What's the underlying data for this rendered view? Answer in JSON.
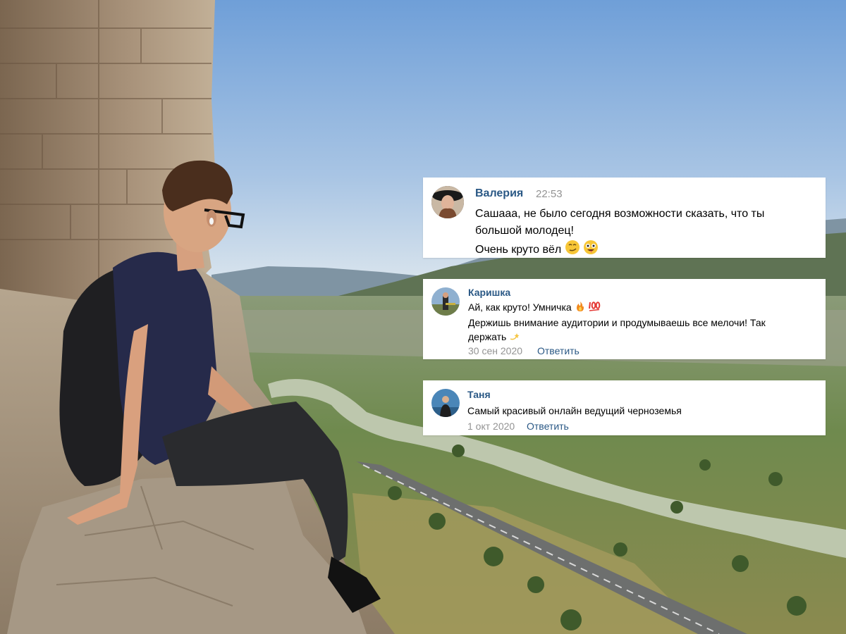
{
  "photo": {
    "description_icon": "landscape-photo",
    "colors": {
      "sky_top": "#6e9fd7",
      "sky_bottom": "#d7e4ef",
      "stone": "#a89277",
      "river": "#b9c6a9",
      "greenery": "#5d7a3f"
    }
  },
  "comments": [
    {
      "author": "Валерия",
      "time": "22:53",
      "lines": [
        "Сашааа, не было сегодня возможности сказать, что ты",
        "большой молодец!",
        "Очень круто вёл"
      ],
      "emoji_icons": [
        "smirk-face-icon",
        "zany-face-icon"
      ]
    },
    {
      "author": "Каришка",
      "lines": [
        "Ай, как круто! Умничка",
        "Держишь внимание аудитории и продумываешь все мелочи! Так",
        "держать"
      ],
      "emoji_icons": [
        "fire-icon",
        "hundred-points-icon",
        "dizzy-icon"
      ],
      "date": "30 сен 2020",
      "reply_label": "Ответить"
    },
    {
      "author": "Таня",
      "lines": [
        "Самый красивый онлайн ведущий черноземья"
      ],
      "date": "1 окт 2020",
      "reply_label": "Ответить"
    }
  ],
  "ui_colors": {
    "link": "#2a5885",
    "muted": "#939393",
    "card_bg": "#ffffff"
  }
}
